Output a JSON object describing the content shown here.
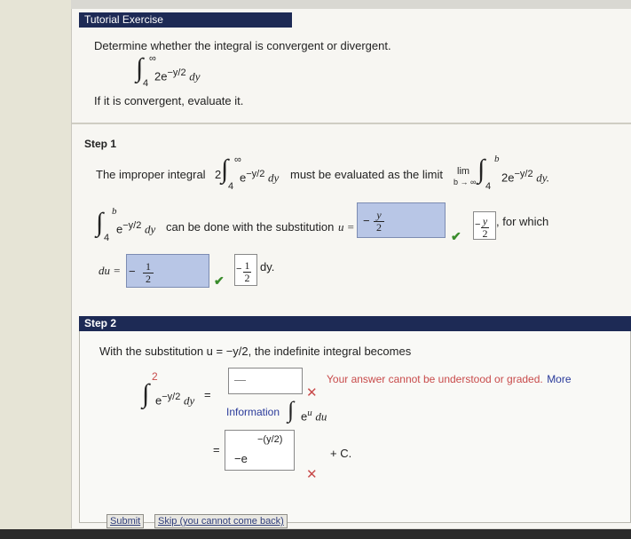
{
  "tutorial": {
    "title": "Tutorial Exercise",
    "prompt": "Determine whether the integral is convergent or divergent.",
    "integral": {
      "upper": "∞",
      "lower": "4",
      "integrand": "2e",
      "exponent": "−y/2",
      "dvar": "dy"
    },
    "instruction": "If it is convergent, evaluate it."
  },
  "step1": {
    "heading": "Step 1",
    "sentence_start": "The improper integral",
    "coef": "2",
    "upper": "∞",
    "lower": "4",
    "integrand": "e",
    "exponent": "−y/2",
    "dvar": "dy",
    "sentence_mid": "must be evaluated as the limit",
    "lim": "lim",
    "lim_sub": "b → ∞",
    "upper_b": "b",
    "integrand2": "2e",
    "dvar2": "dy.",
    "sub_upper": "b",
    "sub_lower": "4",
    "sub_integrand": "e",
    "sub_dvar": "dy",
    "sub_text": "can be done with the substitution",
    "u_eq": "u =",
    "u_answer": {
      "sign": "−",
      "num": "y",
      "den": "2"
    },
    "u_correct": {
      "sign": "−",
      "num": "y",
      "den": "2"
    },
    "for_which": ", for which",
    "du_label": "du =",
    "du_answer": {
      "sign": "−",
      "num": "1",
      "den": "2"
    },
    "du_correct": {
      "sign": "−",
      "num": "1",
      "den": "2"
    },
    "du_suffix": "dy."
  },
  "step2": {
    "heading": "Step 2",
    "sentence": "With the substitution  u = −y/2,  the indefinite integral becomes",
    "lhs_coef": "2",
    "lhs_integrand": "e",
    "lhs_exponent": "−y/2",
    "lhs_dvar": "dy",
    "equals": "=",
    "box1_value": "—",
    "error_msg": "Your answer cannot be understood or graded.",
    "more_link": "More",
    "information": "Information",
    "eu_integrand": "e",
    "eu_exponent": "u",
    "eu_dvar": "du",
    "equals2": "=",
    "box2_value": "−e",
    "box2_exponent": "−(y/2)",
    "plus_c": "+ C."
  },
  "buttons": {
    "submit": "Submit",
    "skip": "Skip (you cannot come back)"
  },
  "colors": {
    "titlebar": "#1d2a55",
    "answer_fill": "#b8c6e6",
    "check": "#3a8c2c",
    "cross": "#c84b4b"
  }
}
